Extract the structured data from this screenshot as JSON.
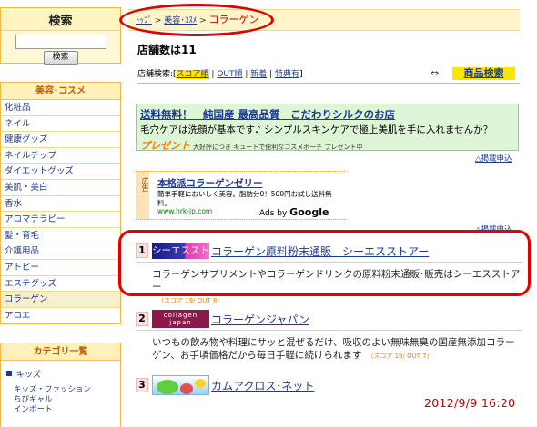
{
  "sidebar": {
    "search_title": "検索",
    "search_button": "検索",
    "category_title": "美容･コスメ",
    "categories": [
      "化粧品",
      "ネイル",
      "健康グッズ",
      "ネイルチップ",
      "ダイエットグッズ",
      "美肌・美白",
      "香水",
      "アロマテラピー",
      "髪・育毛",
      "介護用品",
      "アトピー",
      "エステグッズ",
      "コラーゲン",
      "アロエ"
    ],
    "category_list_title": "カテゴリ一覧",
    "kids_label": "キッズ",
    "kids_items": [
      "キッズ・ファッション",
      "ちびギャル",
      "インポート"
    ]
  },
  "breadcrumb": {
    "top": "ﾄｯﾌﾟ",
    "sep1": " > ",
    "beauty": "美容･ｺｽﾒ",
    "sep2": " > ",
    "current": "コラーゲン"
  },
  "main": {
    "store_count": "店舗数は11",
    "sort_label": "店舗検索:[",
    "sort_score": "スコア順",
    "sort_out": "OUT順",
    "sort_new": "新着",
    "sort_special": "特典有",
    "sort_close": "]",
    "divider": " | ",
    "arrow": "⇔",
    "product_search": "商品検索"
  },
  "ad_banner": {
    "title": "送料無料！　純国産 最高品質　こだわりシルクのお店",
    "desc": "毛穴ケアは洗顔が基本です♪ シンプルスキンケアで極上美肌を手に入れませんか？",
    "present_tag": "プレゼント",
    "present_text": "大好評につき キュートで便利なコスメポーチ プレゼント中",
    "more_link": "△掲載申込"
  },
  "google_ad": {
    "label": "広告",
    "title": "本格派コラーゲンゼリー",
    "desc": "簡単手軽においしく美容。脂肪分0！500円お試し送料無料。",
    "url": "www.hrk-jp.com",
    "ads_by": "Ads by ",
    "google": "Google",
    "more_link": "△掲載申込"
  },
  "stores": [
    {
      "rank": "1",
      "logo": "シーエスストアー",
      "name": "コラーゲン原料粉末通販　シーエスストアー",
      "desc": "コラーゲンサプリメントやコラーゲンドリンクの原料粉末通販･販売はシーエスストアー",
      "score": "（スコア 19/ OUT 8）"
    },
    {
      "rank": "2",
      "logo_line1": "collagen",
      "logo_line2": "japan",
      "name": "コラーゲンジャパン",
      "desc": "いつもの飲み物や料理にサッと混ぜるだけ、吸収のよい無味無臭の国産無添加コラーゲン、お手頃価格だから毎日手軽に続けられます",
      "score": "（スコア 19/ OUT 7）"
    },
    {
      "rank": "3",
      "name": "カムアクロス･ネット"
    }
  ],
  "timestamp": "2012/9/9 16:20",
  "colors": {
    "accent_red": "#e00000",
    "link_blue": "#1d3a8f",
    "highlight_yellow": "#ffe400",
    "ad_green": "#dff5d8"
  }
}
